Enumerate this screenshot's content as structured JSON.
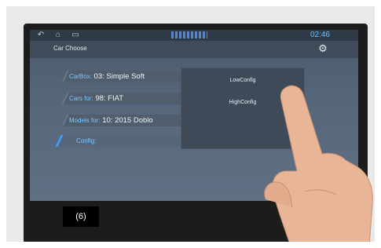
{
  "screen": {
    "time": "02:46",
    "title": "Car Choose",
    "car_box": {
      "label": "CarBox:",
      "value": "03: Simple Soft"
    },
    "cars_for": {
      "label": "Cars for:",
      "value": "98: FIAT"
    },
    "models_for": {
      "label": "Models for:",
      "value": "10: 2015 Doblo"
    },
    "config": {
      "label": "Config:"
    },
    "config_options": [
      "LowConfig",
      "HighConfig"
    ]
  },
  "caption": "(6)"
}
